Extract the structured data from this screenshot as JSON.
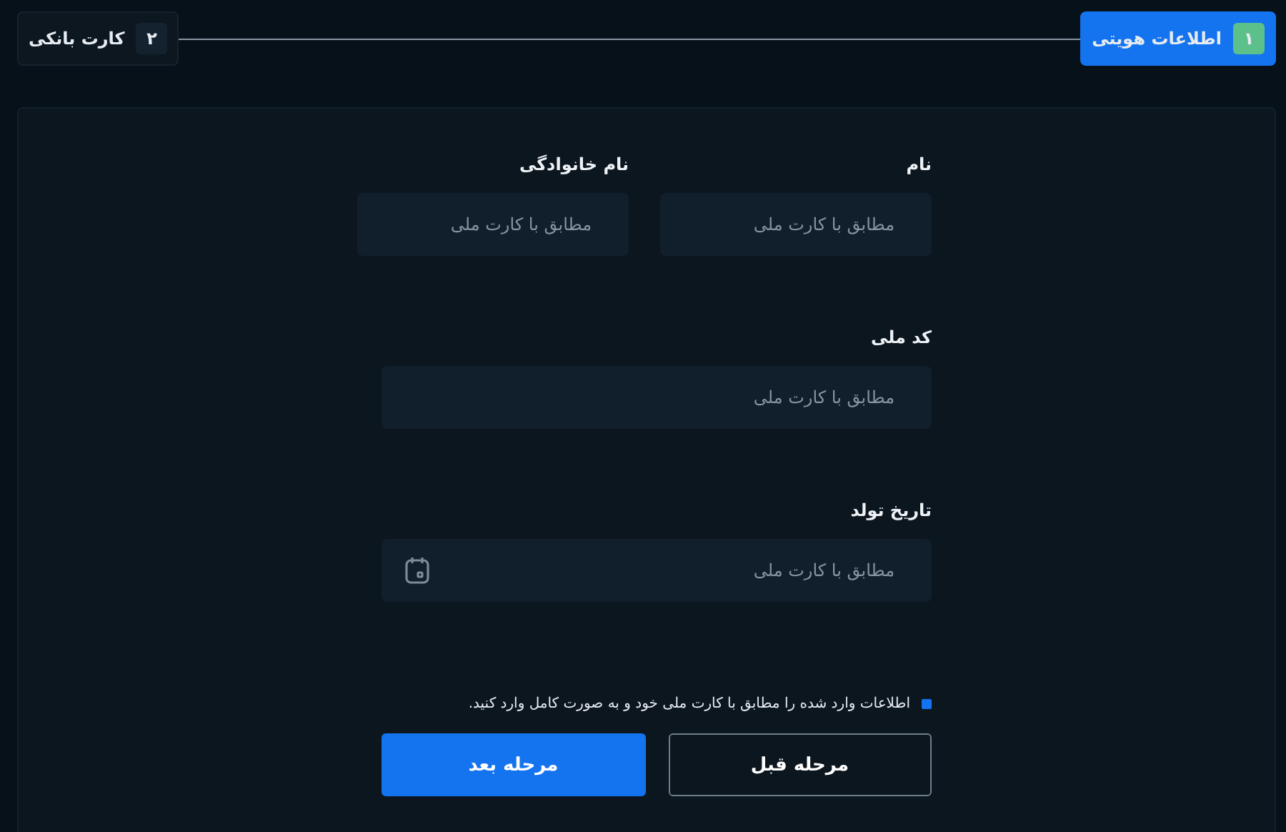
{
  "steps": [
    {
      "number": "۱",
      "label": "اطلاعات هویتی",
      "selected": true
    },
    {
      "number": "۲",
      "label": "کارت بانکی",
      "selected": false
    }
  ],
  "form": {
    "rows": [
      [
        {
          "kind": "text",
          "label": "نام",
          "placeholder": "مطابق با کارت ملی"
        },
        {
          "kind": "text",
          "label": "نام خانوادگی",
          "placeholder": "مطابق با کارت ملی"
        }
      ],
      [
        {
          "kind": "text",
          "label": "کد ملی",
          "placeholder": "مطابق با کارت ملی"
        }
      ],
      [
        {
          "kind": "date",
          "label": "تاریخ تولد",
          "placeholder": "مطابق با کارت ملی"
        }
      ]
    ],
    "note": "اطلاعات وارد شده را مطابق با کارت ملی خود و به صورت کامل وارد کنید.",
    "buttons": [
      {
        "kind": "outline",
        "label": "مرحله قبل"
      },
      {
        "kind": "primary",
        "label": "مرحله بعد"
      }
    ]
  }
}
